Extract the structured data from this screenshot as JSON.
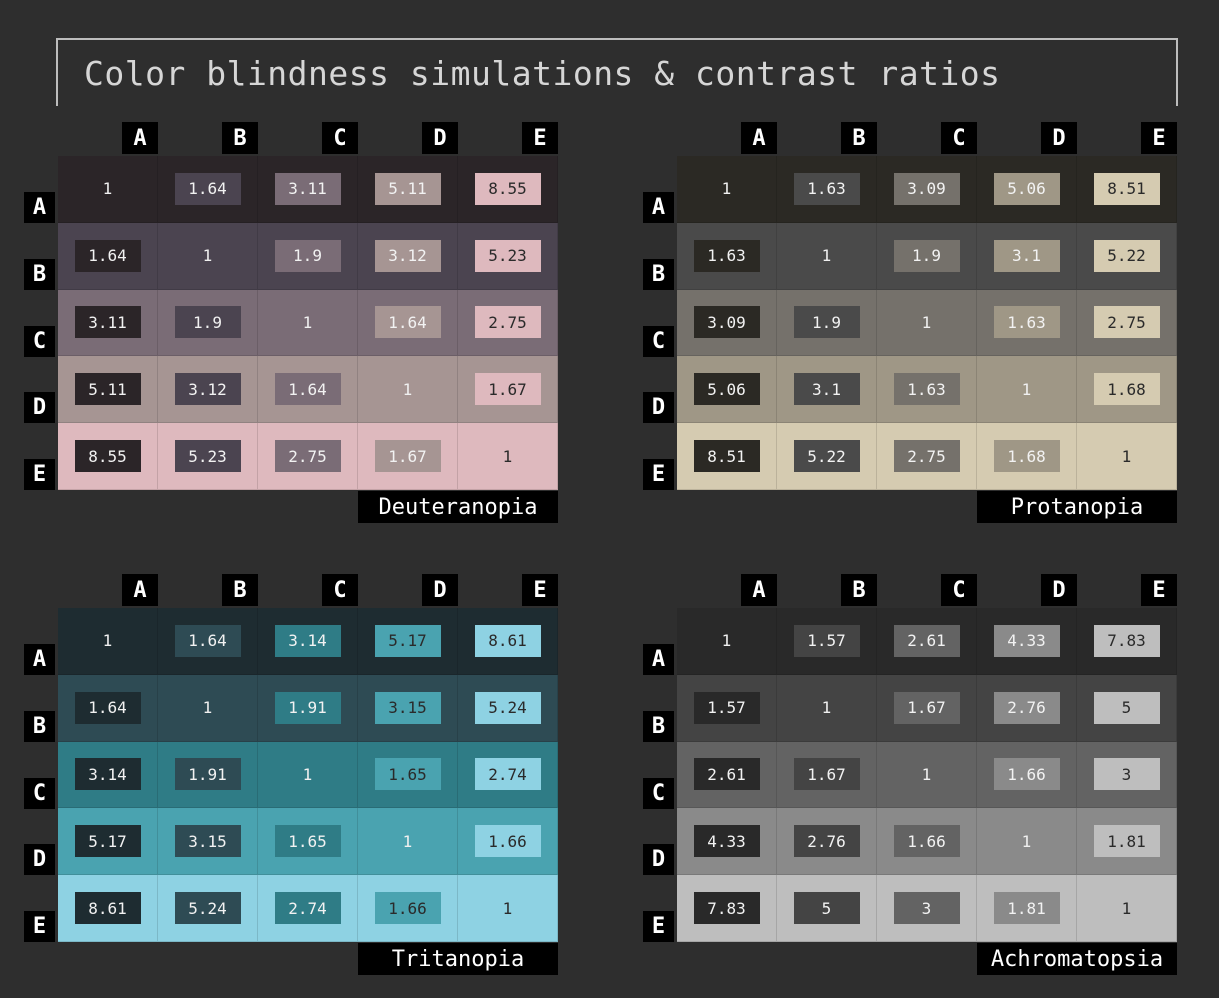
{
  "title": "Color blindness simulations & contrast ratios",
  "headers": [
    "A",
    "B",
    "C",
    "D",
    "E"
  ],
  "panels": [
    {
      "name": "Deuteranopia",
      "colors": [
        "#2b2528",
        "#4b4450",
        "#7a6c76",
        "#a69593",
        "#deb9be"
      ],
      "ratios": [
        [
          "1",
          "1.64",
          "3.11",
          "5.11",
          "8.55"
        ],
        [
          "1.64",
          "1",
          "1.9",
          "3.12",
          "5.23"
        ],
        [
          "3.11",
          "1.9",
          "1",
          "1.64",
          "2.75"
        ],
        [
          "5.11",
          "3.12",
          "1.64",
          "1",
          "1.67"
        ],
        [
          "8.55",
          "5.23",
          "2.75",
          "1.67",
          "1"
        ]
      ]
    },
    {
      "name": "Protanopia",
      "colors": [
        "#2b2924",
        "#4a4a4a",
        "#75716b",
        "#9f9786",
        "#d5cbb1"
      ],
      "ratios": [
        [
          "1",
          "1.63",
          "3.09",
          "5.06",
          "8.51"
        ],
        [
          "1.63",
          "1",
          "1.9",
          "3.1",
          "5.22"
        ],
        [
          "3.09",
          "1.9",
          "1",
          "1.63",
          "2.75"
        ],
        [
          "5.06",
          "3.1",
          "1.63",
          "1",
          "1.68"
        ],
        [
          "8.51",
          "5.22",
          "2.75",
          "1.68",
          "1"
        ]
      ]
    },
    {
      "name": "Tritanopia",
      "colors": [
        "#1e2c31",
        "#2e4b54",
        "#2f7c86",
        "#4aa3b0",
        "#8ed2e3"
      ],
      "ratios": [
        [
          "1",
          "1.64",
          "3.14",
          "5.17",
          "8.61"
        ],
        [
          "1.64",
          "1",
          "1.91",
          "3.15",
          "5.24"
        ],
        [
          "3.14",
          "1.91",
          "1",
          "1.65",
          "2.74"
        ],
        [
          "5.17",
          "3.15",
          "1.65",
          "1",
          "1.66"
        ],
        [
          "8.61",
          "5.24",
          "2.74",
          "1.66",
          "1"
        ]
      ]
    },
    {
      "name": "Achromatopsia",
      "colors": [
        "#292929",
        "#444444",
        "#636363",
        "#8a8a8a",
        "#bebebe"
      ],
      "ratios": [
        [
          "1",
          "1.57",
          "2.61",
          "4.33",
          "7.83"
        ],
        [
          "1.57",
          "1",
          "1.67",
          "2.76",
          "5"
        ],
        [
          "2.61",
          "1.67",
          "1",
          "1.66",
          "3"
        ],
        [
          "4.33",
          "2.76",
          "1.66",
          "1",
          "1.81"
        ],
        [
          "7.83",
          "5",
          "3",
          "1.81",
          "1"
        ]
      ]
    }
  ]
}
